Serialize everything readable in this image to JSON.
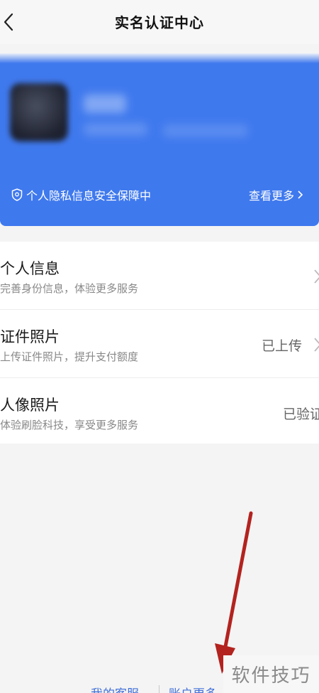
{
  "header": {
    "title": "实名认证中心"
  },
  "banner": {
    "privacy_text": "个人隐私信息安全保障中",
    "view_more": "查看更多"
  },
  "list": {
    "items": [
      {
        "title": "个人信息",
        "subtitle": "完善身份信息，体验更多服务",
        "status": ""
      },
      {
        "title": "证件照片",
        "subtitle": "上传证件照片，提升支付额度",
        "status": "已上传"
      },
      {
        "title": "人像照片",
        "subtitle": "体验刷脸科技，享受更多服务",
        "status": "已验证"
      }
    ]
  },
  "footer": {
    "customer_service": "我的客服",
    "account_more": "账户更多"
  },
  "watermark": {
    "text": "软件技巧"
  },
  "colors": {
    "banner": "#3f79ee",
    "annotation_arrow": "#b3231f",
    "link": "#3f6fd8"
  }
}
